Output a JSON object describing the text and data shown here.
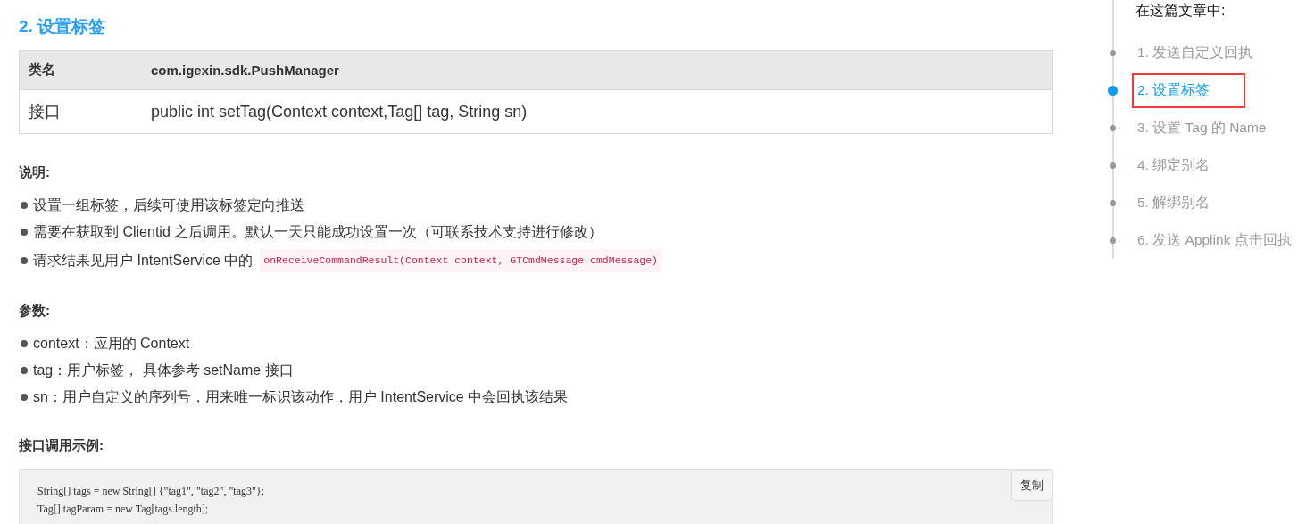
{
  "article": {
    "heading": "2. 设置标签",
    "table": {
      "rows": [
        {
          "kind": "header",
          "cells": [
            "类名",
            "com.igexin.sdk.PushManager"
          ]
        },
        {
          "kind": "body",
          "cells": [
            "接口",
            "public int setTag(Context context,Tag[] tag, String sn)"
          ]
        }
      ]
    },
    "sections": [
      {
        "title": "说明:",
        "items": [
          {
            "text": "设置一组标签，后续可使用该标签定向推送"
          },
          {
            "text": "需要在获取到 Clientid 之后调用。默认一天只能成功设置一次（可联系技术支持进行修改）"
          },
          {
            "text": "请求结果见用户 IntentService 中的",
            "code": "onReceiveCommandResult(Context context, GTCmdMessage cmdMessage)"
          }
        ]
      },
      {
        "title": "参数:",
        "items": [
          {
            "text": "context：应用的 Context"
          },
          {
            "text": "tag：用户标签， 具体参考 setName 接口"
          },
          {
            "text": "sn：用户自定义的序列号，用来唯一标识该动作，用户 IntentService 中会回执该结果"
          }
        ]
      },
      {
        "title": "接口调用示例:",
        "code_block": {
          "copy_button": "复制",
          "lines": [
            "String[] tags = new String[] {\"tag1\", \"tag2\", \"tag3\"};",
            "Tag[] tagParam = new Tag[tags.length];"
          ]
        }
      }
    ]
  },
  "toc": {
    "title": "在这篇文章中:",
    "items": [
      {
        "label": "1. 发送自定义回执",
        "selected": false,
        "annotated": false
      },
      {
        "label": "2. 设置标签",
        "selected": true,
        "annotated": true
      },
      {
        "label": "3. 设置 Tag 的 Name",
        "selected": false,
        "annotated": false
      },
      {
        "label": "4. 绑定别名",
        "selected": false,
        "annotated": false
      },
      {
        "label": "5. 解绑别名",
        "selected": false,
        "annotated": false
      },
      {
        "label": "6. 发送 Applink 点击回执",
        "selected": false,
        "annotated": false
      }
    ]
  }
}
